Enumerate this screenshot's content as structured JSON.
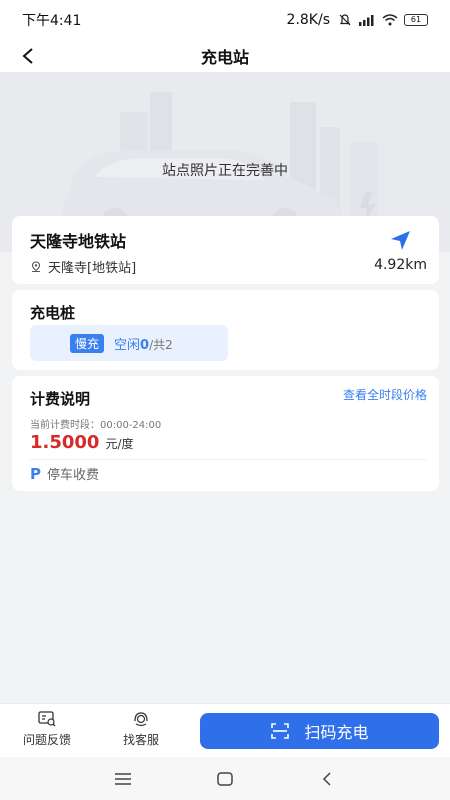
{
  "status_bar": {
    "time": "下午4:41",
    "network_speed": "2.8K/s",
    "battery": "61",
    "icons": [
      "mute-bell-icon",
      "signal-icon",
      "wifi-icon",
      "battery-icon"
    ]
  },
  "nav": {
    "title": "充电站",
    "back_icon": "back-arrow-icon"
  },
  "hero": {
    "caption": "站点照片正在完善中"
  },
  "station": {
    "name": "天隆寺地铁站",
    "address": "天隆寺[地铁站]",
    "distance": "4.92km",
    "address_icon": "location-pin-icon",
    "navigate_icon": "navigate-arrow-icon"
  },
  "piles": {
    "title": "充电桩",
    "badge": "慢充",
    "status_label": "空闲",
    "free_count": "0",
    "total_text": "/共2"
  },
  "fee": {
    "title": "计费说明",
    "all_periods_link": "查看全时段价格",
    "current_period": "当前计费时段：00:00-24:00",
    "price": "1.5000",
    "price_unit": "元/度",
    "parking_icon_text": "P",
    "parking_text": "停车收费"
  },
  "bottom": {
    "feedback_label": "问题反馈",
    "service_label": "找客服",
    "scan_label": "扫码充电",
    "accent_color": "#2f6fea"
  },
  "colors": {
    "accent": "#3a7ff0",
    "price": "#d62b2b",
    "background": "#f2f3f5"
  }
}
